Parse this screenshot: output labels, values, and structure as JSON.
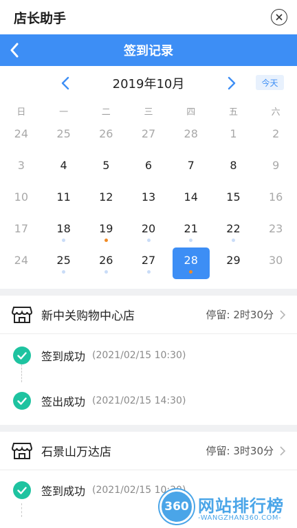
{
  "app": {
    "title": "店长助手"
  },
  "nav": {
    "title": "签到记录"
  },
  "calendar": {
    "month_label": "2019年10月",
    "today_label": "今天",
    "weekdays": [
      "日",
      "一",
      "二",
      "三",
      "四",
      "五",
      "六"
    ],
    "weeks": [
      [
        {
          "d": "24",
          "m": true,
          "dot": ""
        },
        {
          "d": "25",
          "m": true,
          "dot": ""
        },
        {
          "d": "26",
          "m": true,
          "dot": ""
        },
        {
          "d": "27",
          "m": true,
          "dot": ""
        },
        {
          "d": "28",
          "m": true,
          "dot": ""
        },
        {
          "d": "1",
          "m": true,
          "dot": ""
        },
        {
          "d": "2",
          "m": true,
          "dot": ""
        }
      ],
      [
        {
          "d": "3",
          "m": true,
          "dot": ""
        },
        {
          "d": "4",
          "m": false,
          "dot": ""
        },
        {
          "d": "5",
          "m": false,
          "dot": ""
        },
        {
          "d": "6",
          "m": false,
          "dot": ""
        },
        {
          "d": "7",
          "m": false,
          "dot": ""
        },
        {
          "d": "8",
          "m": false,
          "dot": ""
        },
        {
          "d": "9",
          "m": true,
          "dot": ""
        }
      ],
      [
        {
          "d": "10",
          "m": true,
          "dot": ""
        },
        {
          "d": "11",
          "m": false,
          "dot": ""
        },
        {
          "d": "12",
          "m": false,
          "dot": ""
        },
        {
          "d": "13",
          "m": false,
          "dot": ""
        },
        {
          "d": "14",
          "m": false,
          "dot": ""
        },
        {
          "d": "15",
          "m": false,
          "dot": ""
        },
        {
          "d": "16",
          "m": true,
          "dot": ""
        }
      ],
      [
        {
          "d": "17",
          "m": true,
          "dot": ""
        },
        {
          "d": "18",
          "m": false,
          "dot": "blue"
        },
        {
          "d": "19",
          "m": false,
          "dot": "orange"
        },
        {
          "d": "20",
          "m": false,
          "dot": "blue"
        },
        {
          "d": "21",
          "m": false,
          "dot": "blue"
        },
        {
          "d": "22",
          "m": false,
          "dot": "blue"
        },
        {
          "d": "23",
          "m": true,
          "dot": ""
        }
      ],
      [
        {
          "d": "24",
          "m": true,
          "dot": ""
        },
        {
          "d": "25",
          "m": false,
          "dot": "blue"
        },
        {
          "d": "26",
          "m": false,
          "dot": "blue"
        },
        {
          "d": "27",
          "m": false,
          "dot": "blue"
        },
        {
          "d": "28",
          "m": false,
          "dot": "orange",
          "selected": true
        },
        {
          "d": "29",
          "m": false,
          "dot": ""
        },
        {
          "d": "30",
          "m": true,
          "dot": ""
        }
      ]
    ]
  },
  "stores": [
    {
      "name": "新中关购物中心店",
      "stay": "停留: 2时30分",
      "records": [
        {
          "label": "签到成功",
          "time": "(2021/02/15 10:30)"
        },
        {
          "label": "签出成功",
          "time": "(2021/02/15 14:30)"
        }
      ]
    },
    {
      "name": "石景山万达店",
      "stay": "停留: 3时30分",
      "records": [
        {
          "label": "签到成功",
          "time": "(2021/02/15 10:30)"
        }
      ]
    }
  ],
  "watermark": {
    "badge": "360",
    "text": "网站排行榜",
    "sub": "-WANGZHAN360.COM-"
  },
  "colors": {
    "primary": "#3d8ef5",
    "success": "#1ec3a0",
    "accent": "#f08a24"
  }
}
